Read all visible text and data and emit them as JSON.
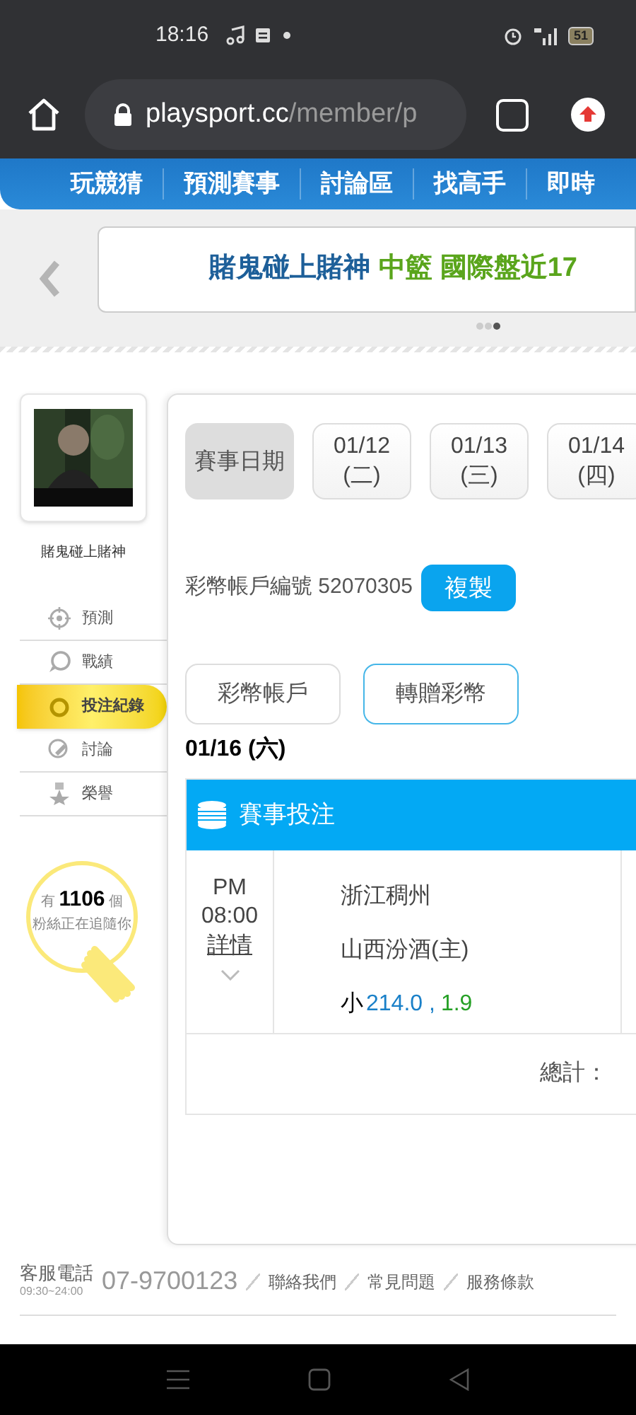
{
  "status_bar": {
    "time": "18:16",
    "battery": "51"
  },
  "browser": {
    "url_host": "playsport.cc",
    "url_path": "/member/p"
  },
  "nav": {
    "items": [
      "玩競猜",
      "預測賽事",
      "討論區",
      "找高手",
      "即時"
    ]
  },
  "banner": {
    "title": "賭鬼碰上賭神",
    "subtitle": "中籃 國際盤近17",
    "dots": [
      {
        "selected": false
      },
      {
        "selected": false
      },
      {
        "selected": true
      }
    ]
  },
  "profile": {
    "name": "賭鬼碰上賭神",
    "fans_text": "有 **1106** 個",
    "fans_sub": "粉絲正在追隨你"
  },
  "sidebar": {
    "items": [
      {
        "label": "預測",
        "kind": "target",
        "selected": false
      },
      {
        "label": "戰績",
        "kind": "chat",
        "selected": false
      },
      {
        "label": "投注紀錄",
        "kind": "ring",
        "selected": true
      },
      {
        "label": "討論",
        "kind": "pen",
        "selected": false
      },
      {
        "label": "榮譽",
        "kind": "medal",
        "selected": false
      }
    ]
  },
  "date_tabs": [
    {
      "label": "賽事日期",
      "selected": true
    },
    {
      "label": "01/12",
      "sub": "(二)",
      "selected": false
    },
    {
      "label": "01/13",
      "sub": "(三)",
      "selected": false
    },
    {
      "label": "01/14",
      "sub": "(四)",
      "selected": false
    }
  ],
  "account": {
    "label": "彩幣帳戶編號 52070305",
    "copy_button": "複製"
  },
  "account_tabs": [
    {
      "label": "彩幣帳戶",
      "selected": false
    },
    {
      "label": "轉贈彩幣",
      "selected": true
    }
  ],
  "day_heading": "01/16 (六)",
  "table": {
    "header": "賽事投注",
    "rows": [
      {
        "ampm": "PM",
        "time": "08:00",
        "detail_link": "詳情",
        "away": "浙江稠州",
        "home": "山西汾酒(主)",
        "bet": "小",
        "line": "214.0 ,",
        "odds": "1.9"
      }
    ],
    "total_label": "總計："
  },
  "footer": {
    "phone_label": "客服電話",
    "hours": "09:30~24:00",
    "phone": "07-9700123",
    "links": [
      "聯絡我們",
      "常見問題",
      "服務條款"
    ]
  }
}
